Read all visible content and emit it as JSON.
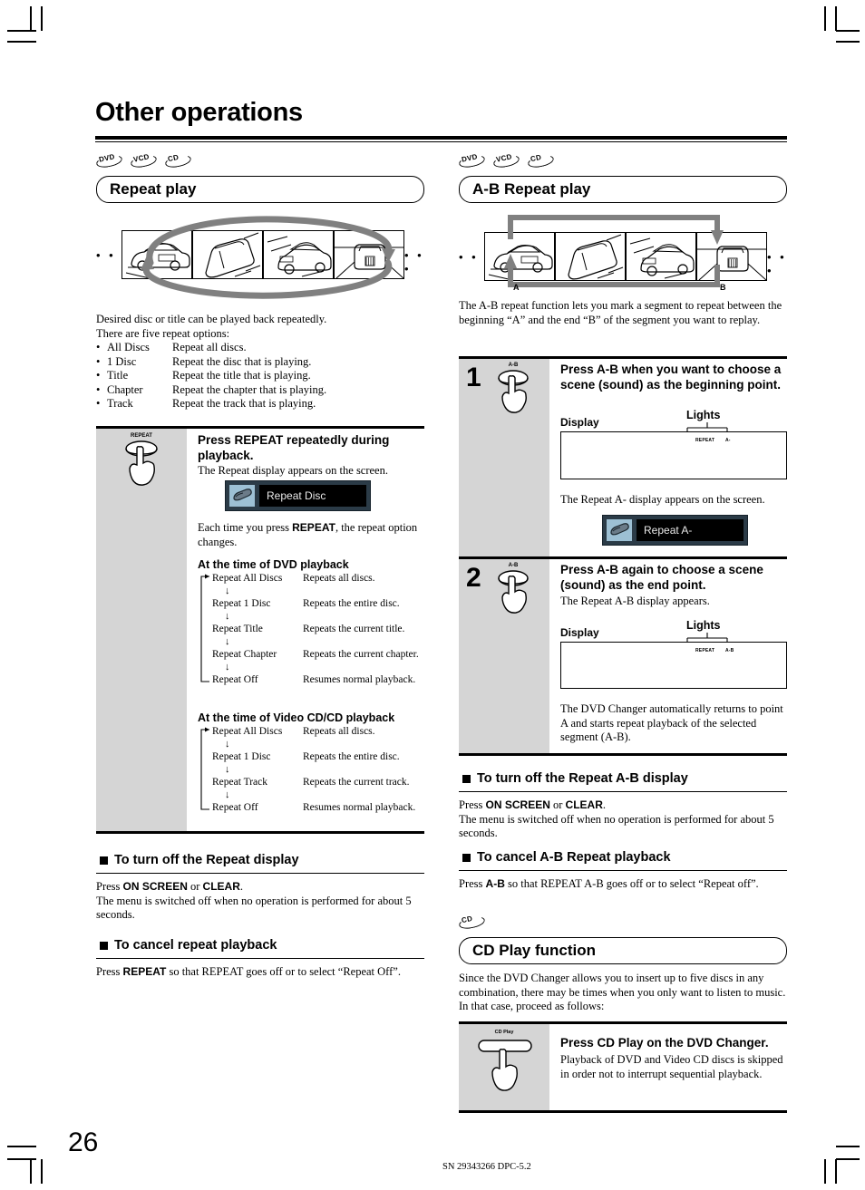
{
  "page": {
    "title": "Other operations",
    "number": "26",
    "footer": "SN 29343266 DPC-5.2"
  },
  "left": {
    "badges": [
      "DVD",
      "VCD",
      "CD"
    ],
    "heading": "Repeat play",
    "dots_left": "• • •",
    "dots_right": "• • •",
    "intro_line1": "Desired disc or title can be played back repeatedly.",
    "intro_line2": "There are five repeat options:",
    "options": [
      {
        "name": "All Discs",
        "desc": "Repeat all discs."
      },
      {
        "name": "1 Disc",
        "desc": "Repeat the disc that is playing."
      },
      {
        "name": "Title",
        "desc": "Repeat the title that is playing."
      },
      {
        "name": "Chapter",
        "desc": "Repeat the chapter that is playing."
      },
      {
        "name": "Track",
        "desc": "Repeat the track that is playing."
      }
    ],
    "step": {
      "button_label": "REPEAT",
      "heading": "Press REPEAT repeatedly during playback.",
      "sub": "The Repeat display appears on the screen.",
      "osd_text": "Repeat Disc",
      "after_osd_1": "Each time you press ",
      "after_osd_bold": "REPEAT",
      "after_osd_2": ", the repeat option changes."
    },
    "dvd_flow": {
      "title": "At the time of DVD playback",
      "rows": [
        {
          "name": "Repeat All Discs",
          "desc": "Repeats all discs."
        },
        {
          "name": "Repeat 1 Disc",
          "desc": "Repeats the entire disc."
        },
        {
          "name": "Repeat Title",
          "desc": "Repeats the current title."
        },
        {
          "name": "Repeat Chapter",
          "desc": "Repeats the current chapter."
        },
        {
          "name": "Repeat Off",
          "desc": "Resumes normal playback."
        }
      ]
    },
    "vcd_flow": {
      "title": "At the time of Video CD/CD playback",
      "rows": [
        {
          "name": "Repeat All Discs",
          "desc": "Repeats all discs."
        },
        {
          "name": "Repeat 1 Disc",
          "desc": "Repeats the entire disc."
        },
        {
          "name": "Repeat Track",
          "desc": "Repeats the current track."
        },
        {
          "name": "Repeat Off",
          "desc": "Resumes normal playback."
        }
      ]
    },
    "turn_off": {
      "heading": "To turn off the Repeat display",
      "line1_pre": "Press ",
      "line1_b1": "ON SCREEN",
      "line1_mid": " or ",
      "line1_b2": "CLEAR",
      "line1_post": ".",
      "line2": "The menu is switched off when no operation is performed for about 5 seconds."
    },
    "cancel": {
      "heading": "To cancel repeat playback",
      "pre": "Press ",
      "bold": "REPEAT",
      "post": " so that REPEAT goes off or to select “Repeat Off”."
    }
  },
  "right": {
    "badges": [
      "DVD",
      "VCD",
      "CD"
    ],
    "heading": "A-B Repeat play",
    "dots_left": "• • •",
    "dots_right": "• • •",
    "marker_a": "A",
    "marker_b": "B",
    "intro": "The A-B repeat function lets you mark a segment to repeat between the beginning “A” and the end “B” of the segment you want to replay.",
    "step1": {
      "number": "1",
      "button_label": "A-B",
      "heading": "Press A-B when you want to choose a scene (sound) as the beginning point.",
      "display_label": "Display",
      "lights_label": "Lights",
      "light1": "REPEAT",
      "light2": "A-",
      "after": "The Repeat A- display appears on the screen.",
      "osd_text": "Repeat A-"
    },
    "step2": {
      "number": "2",
      "button_label": "A-B",
      "heading": "Press A-B again to choose a scene (sound) as the end point.",
      "sub": "The Repeat A-B display appears.",
      "display_label": "Display",
      "lights_label": "Lights",
      "light1": "REPEAT",
      "light2": "A-B",
      "after": "The DVD Changer automatically returns to point A and starts repeat playback of the selected segment (A-B)."
    },
    "turn_off": {
      "heading": "To turn off the Repeat A-B display",
      "line1_pre": "Press ",
      "line1_b1": "ON SCREEN",
      "line1_mid": " or ",
      "line1_b2": "CLEAR",
      "line1_post": ".",
      "line2": "The menu is switched off when no operation is performed for about 5 seconds."
    },
    "cancel": {
      "heading": "To cancel A-B Repeat playback",
      "pre": "Press ",
      "bold": "A-B",
      "post": " so that REPEAT A-B goes off or to select “Repeat off”."
    },
    "cdplay": {
      "badges": [
        "CD"
      ],
      "heading": "CD Play function",
      "intro": "Since the DVD Changer allows you to insert up to five discs in any combination, there may be times when you only want to listen to music. In that case, proceed as follows:",
      "button_label": "CD Play",
      "step_heading": "Press CD Play on the DVD Changer.",
      "step_body": "Playback of DVD and Video CD discs is skipped in order not to interrupt sequential playback."
    }
  }
}
